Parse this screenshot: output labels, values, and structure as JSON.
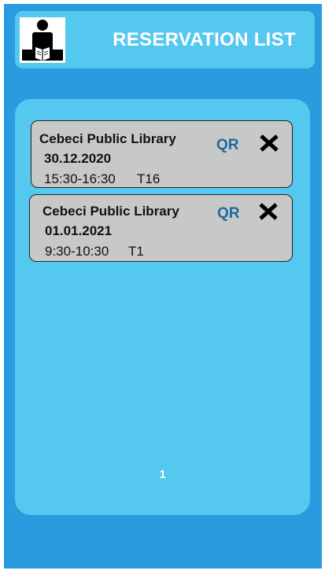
{
  "app": {
    "title": "RESERVATION LIST",
    "logo_icon": "person-reading-book-icon"
  },
  "colors": {
    "background": "#2b9be0",
    "panel": "#55c8f0",
    "card": "#c8c8c8",
    "qr": "#1c6aa0",
    "header_text": "#ffffff"
  },
  "reservations": [
    {
      "library": "Cebeci Public Library",
      "date": "30.12.2020",
      "time": "15:30-16:30",
      "table": "T16",
      "qr_label": "QR",
      "cancel_icon": "close-icon"
    },
    {
      "library": "Cebeci Public Library",
      "date": "01.01.2021",
      "time": "9:30-10:30",
      "table": "T1",
      "qr_label": "QR",
      "cancel_icon": "close-icon"
    }
  ],
  "pagination": {
    "current_page": "1"
  }
}
